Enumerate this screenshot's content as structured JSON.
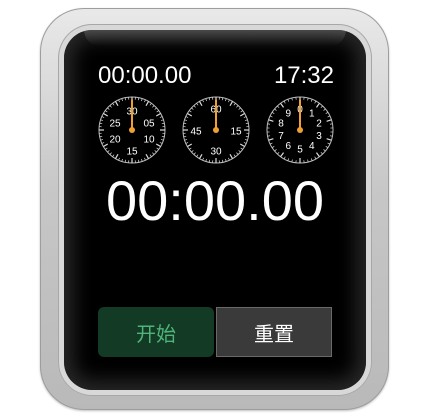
{
  "stopwatch": {
    "lap_time": "00:00.00",
    "clock_time": "17:32",
    "main_time": "00:00.00"
  },
  "dials": [
    {
      "name": "minutes-dial",
      "labels": [
        "30",
        "05",
        "10",
        "15",
        "20",
        "25"
      ],
      "hand_value": 0,
      "scale": 30
    },
    {
      "name": "seconds-dial",
      "labels": [
        "60",
        "15",
        "30",
        "45"
      ],
      "hand_value": 0,
      "scale": 60
    },
    {
      "name": "tenths-dial",
      "labels": [
        "0",
        "1",
        "2",
        "3",
        "4",
        "5",
        "6",
        "7",
        "8",
        "9"
      ],
      "hand_value": 0,
      "scale": 10
    }
  ],
  "controls": {
    "start_label": "开始",
    "reset_label": "重置"
  },
  "colors": {
    "hand": "#f0a033",
    "start_bg": "#123a24",
    "start_text": "#4fb37a",
    "reset_bg": "#3a3a3a"
  }
}
